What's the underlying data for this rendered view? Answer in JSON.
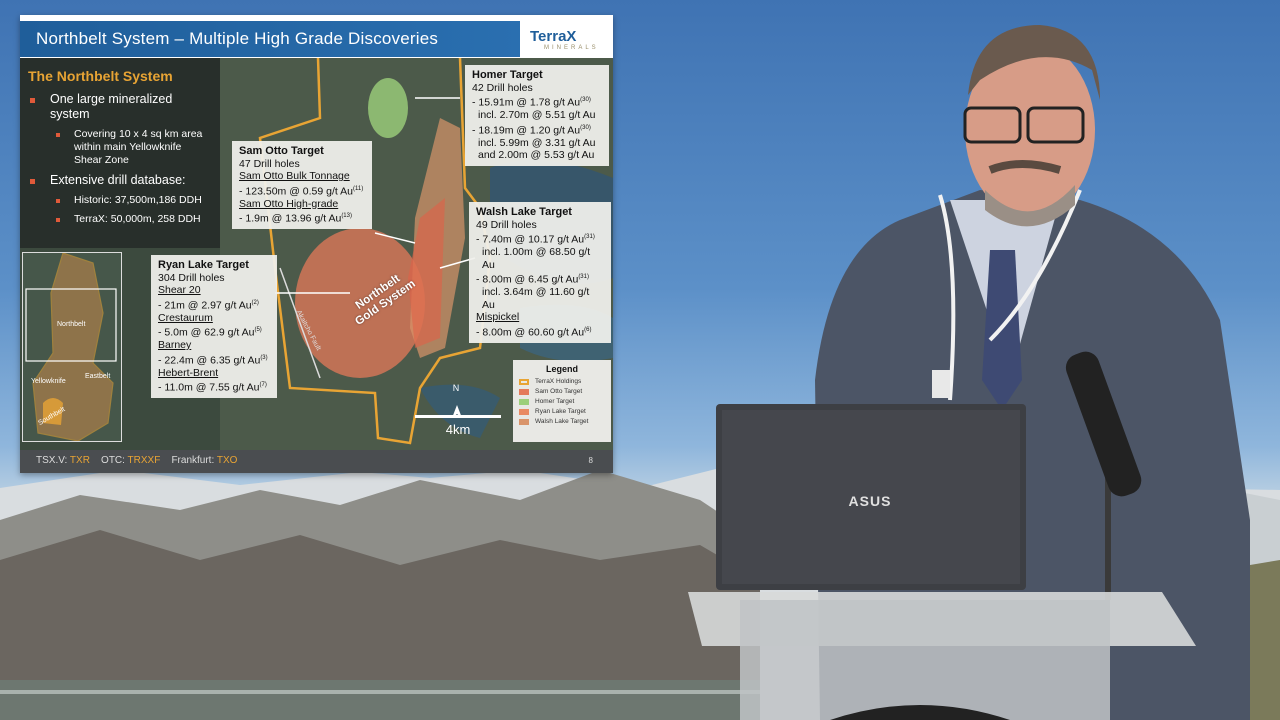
{
  "slide": {
    "title": "Northbelt System – Multiple High Grade Discoveries",
    "brand": {
      "name": "TerraX",
      "sub": "MINERALS"
    },
    "left_panel": {
      "title": "The Northbelt System",
      "items": [
        {
          "text": "One large mineralized system",
          "level": 1
        },
        {
          "text": "Covering 10 x 4 sq km area within main Yellowknife Shear Zone",
          "level": 2
        },
        {
          "text": "Extensive drill database:",
          "level": 1
        },
        {
          "text": "Historic: 37,500m,186 DDH",
          "level": 2
        },
        {
          "text": "TerraX: 50,000m, 258 DDH",
          "level": 2
        }
      ]
    },
    "callouts": {
      "homer": {
        "title": "Homer Target",
        "lines": [
          "42 Drill holes",
          "- 15.91m @ 1.78 g/t Au",
          "incl. 2.70m @ 5.51 g/t Au",
          "- 18.19m @ 1.20 g/t Au",
          "incl. 5.99m @ 3.31 g/t Au",
          "and 2.00m @ 5.53 g/t Au"
        ],
        "sups": [
          "(30)",
          "(30)"
        ]
      },
      "samotto": {
        "title": "Sam Otto Target",
        "lines": [
          "47 Drill holes",
          "Sam Otto Bulk Tonnage",
          "- 123.50m @ 0.59 g/t Au",
          "Sam Otto High-grade",
          "- 1.9m @ 13.96 g/t Au"
        ],
        "sups": [
          "(11)",
          "(13)"
        ]
      },
      "walsh": {
        "title": "Walsh Lake Target",
        "lines": [
          "49 Drill holes",
          "- 7.40m @ 10.17 g/t Au",
          "incl. 1.00m @ 68.50 g/t Au",
          "- 8.00m @ 6.45 g/t Au",
          "incl. 3.64m @ 11.60 g/t Au",
          "Mispickel",
          "- 8.00m @ 60.60 g/t Au"
        ],
        "sups": [
          "(31)",
          "(31)",
          "(6)"
        ]
      },
      "ryan": {
        "title": "Ryan Lake Target",
        "lines": [
          "304 Drill holes",
          "Shear 20",
          "- 21m @ 2.97 g/t Au",
          "Crestaurum",
          "- 5.0m @ 62.9 g/t Au",
          "Barney",
          "- 22.4m @ 6.35 g/t Au",
          "Hebert-Brent",
          "- 11.0m @ 7.55 g/t Au"
        ],
        "sups": [
          "(2)",
          "(5)",
          "(3)",
          "(7)"
        ]
      }
    },
    "map_labels": {
      "system": "Northbelt Gold System",
      "fault": "Akaitcho Fault"
    },
    "inset_labels": {
      "north": "Northbelt",
      "yk": "Yellowknife",
      "east": "Eastbelt",
      "south": "Southbelt"
    },
    "legend": {
      "title": "Legend",
      "items": [
        {
          "label": "TerraX Holdings",
          "color": "#e8a434"
        },
        {
          "label": "Sam Otto Target",
          "color": "#e47a5a"
        },
        {
          "label": "Homer Target",
          "color": "#9ccf7a"
        },
        {
          "label": "Ryan Lake Target",
          "color": "#e98a62"
        },
        {
          "label": "Walsh Lake Target",
          "color": "#d9946a"
        }
      ]
    },
    "scale": {
      "label": "4km",
      "north": "N"
    },
    "footer": {
      "tsx_label": "TSX.V:",
      "tsx": "TXR",
      "otc_label": "OTC:",
      "otc": "TRXXF",
      "fra_label": "Frankfurt:",
      "fra": "TXO",
      "page": "8"
    }
  },
  "laptop": {
    "brand": "ASUS"
  },
  "colors": {
    "header": "#1f5e9a",
    "accent": "#e8a434",
    "bullet": "#e05a3a"
  }
}
